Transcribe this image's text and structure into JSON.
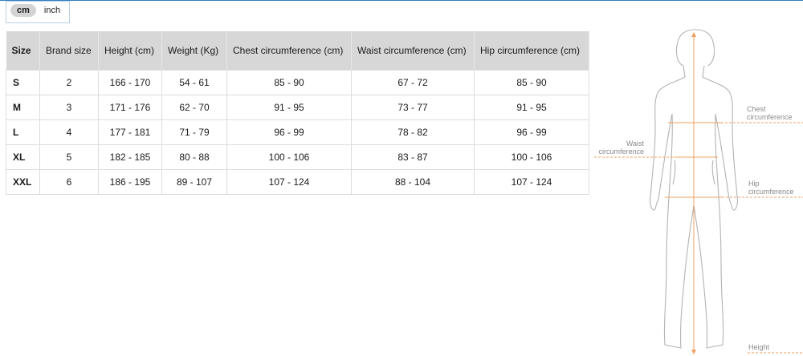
{
  "unit_toggle": {
    "cm": "cm",
    "inch": "inch",
    "selected": "cm"
  },
  "table": {
    "headers": [
      "Size",
      "Brand size",
      "Height (cm)",
      "Weight (Kg)",
      "Chest circumference (cm)",
      "Waist circumference (cm)",
      "Hip circumference (cm)"
    ],
    "rows": [
      [
        "S",
        "2",
        "166 - 170",
        "54 - 61",
        "85 - 90",
        "67 - 72",
        "85 - 90"
      ],
      [
        "M",
        "3",
        "171 - 176",
        "62 - 70",
        "91 - 95",
        "73 - 77",
        "91 - 95"
      ],
      [
        "L",
        "4",
        "177 - 181",
        "71 - 79",
        "96 - 99",
        "78 - 82",
        "96 - 99"
      ],
      [
        "XL",
        "5",
        "182 - 185",
        "80 - 88",
        "100 - 106",
        "83 - 87",
        "100 - 106"
      ],
      [
        "XXL",
        "6",
        "186 - 195",
        "89 - 107",
        "107 - 124",
        "88 - 104",
        "107 - 124"
      ]
    ]
  },
  "figure": {
    "chest_line1": "Chest",
    "chest_line2": "circumference",
    "waist_line1": "Waist",
    "waist_line2": "circumference",
    "hip_line1": "Hip",
    "hip_line2": "circumference",
    "height_label": "Height",
    "accent_color": "#f0a060"
  }
}
